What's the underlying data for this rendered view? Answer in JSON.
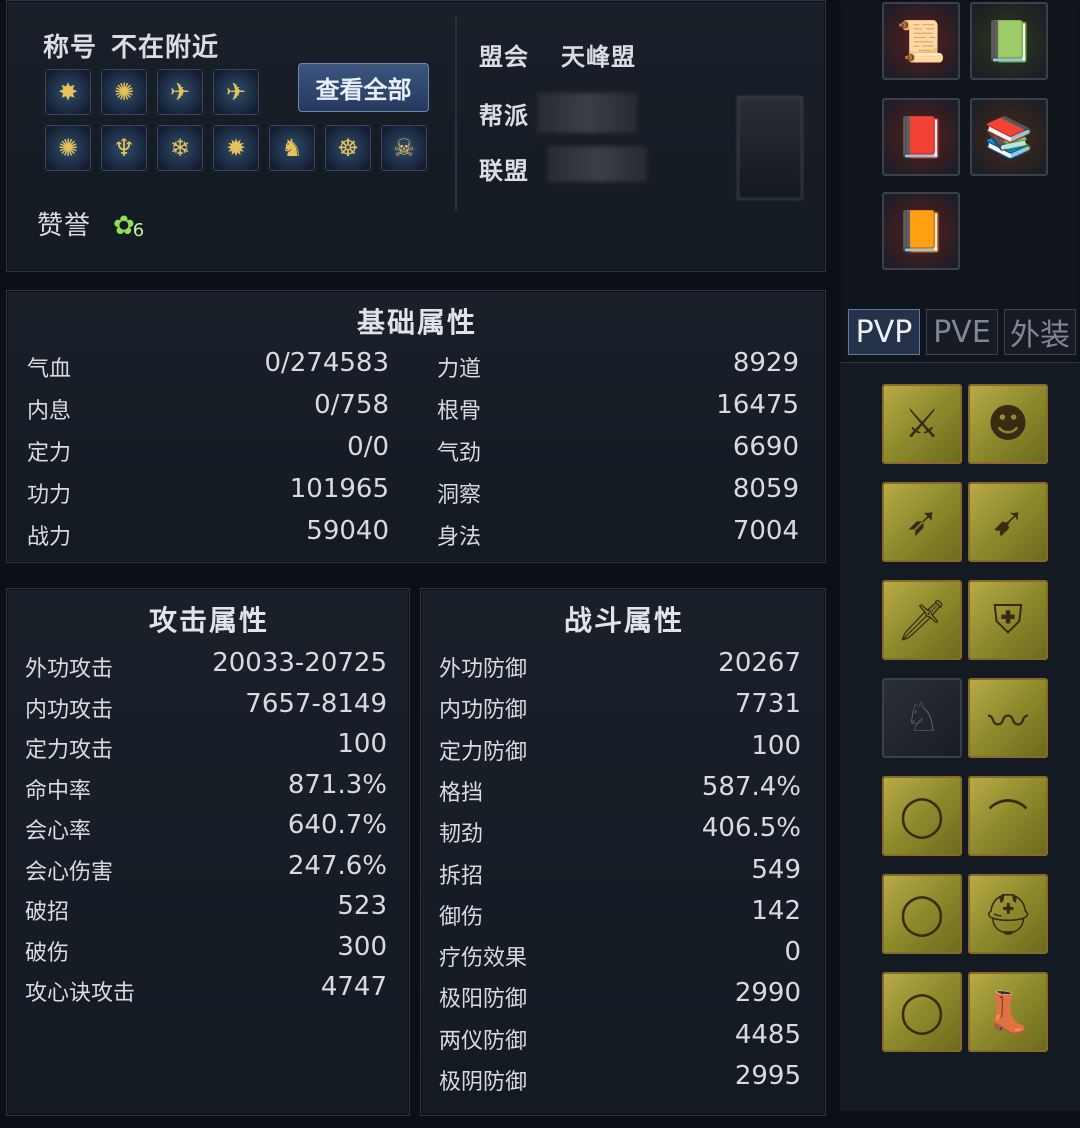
{
  "profile": {
    "title_label": "称号",
    "title_value": "不在附近",
    "view_all": "查看全部",
    "praise_label": "赞誉",
    "praise_count": "6",
    "alliance_label": "盟会",
    "alliance_value": "天峰盟",
    "sect_label": "帮派",
    "union_label": "联盟",
    "title_icons": [
      "red-fan-emblem",
      "gold-fan-emblem",
      "blue-bird-emblem",
      "blue-bird-emblem",
      "gold-fan-emblem",
      "blue-flame-emblem",
      "snowflake-emblem",
      "red-star-emblem",
      "warrior-emblem",
      "gold-mask-emblem",
      "skull-emblem"
    ]
  },
  "basic": {
    "title": "基础属性",
    "left": [
      {
        "label": "气血",
        "value": "0/274583"
      },
      {
        "label": "内息",
        "value": "0/758"
      },
      {
        "label": "定力",
        "value": "0/0"
      },
      {
        "label": "功力",
        "value": "101965"
      },
      {
        "label": "战力",
        "value": "59040"
      }
    ],
    "right": [
      {
        "label": "力道",
        "value": "8929"
      },
      {
        "label": "根骨",
        "value": "16475"
      },
      {
        "label": "气劲",
        "value": "6690"
      },
      {
        "label": "洞察",
        "value": "8059"
      },
      {
        "label": "身法",
        "value": "7004"
      }
    ]
  },
  "attack": {
    "title": "攻击属性",
    "rows": [
      {
        "label": "外功攻击",
        "value": "20033-20725"
      },
      {
        "label": "内功攻击",
        "value": "7657-8149"
      },
      {
        "label": "定力攻击",
        "value": "100"
      },
      {
        "label": "命中率",
        "value": "871.3%"
      },
      {
        "label": "会心率",
        "value": "640.7%"
      },
      {
        "label": "会心伤害",
        "value": "247.6%"
      },
      {
        "label": "破招",
        "value": "523"
      },
      {
        "label": "破伤",
        "value": "300"
      },
      {
        "label": "攻心诀攻击",
        "value": "4747"
      }
    ]
  },
  "combat": {
    "title": "战斗属性",
    "rows": [
      {
        "label": "外功防御",
        "value": "20267"
      },
      {
        "label": "内功防御",
        "value": "7731"
      },
      {
        "label": "定力防御",
        "value": "100"
      },
      {
        "label": "格挡",
        "value": "587.4%"
      },
      {
        "label": "韧劲",
        "value": "406.5%"
      },
      {
        "label": "拆招",
        "value": "549"
      },
      {
        "label": "御伤",
        "value": "142"
      },
      {
        "label": "疗伤效果",
        "value": "0"
      },
      {
        "label": "极阳防御",
        "value": "2990"
      },
      {
        "label": "两仪防御",
        "value": "4485"
      },
      {
        "label": "极阴防御",
        "value": "2995"
      }
    ]
  },
  "tabs": [
    "PVP",
    "PVE",
    "外装"
  ],
  "side_items": [
    "scroll-icon",
    "green-books-icon",
    "red-book-icon",
    "book-stack-icon",
    "red-tome-icon"
  ],
  "equipment": [
    {
      "left": "spear-icon",
      "right": "hair-portrait-icon"
    },
    {
      "left": "bow-icon",
      "right": "red-dart-icon"
    },
    {
      "left": "dagger-icon",
      "right": "armor-chest-icon"
    },
    {
      "left": "horse-icon",
      "right": "sash-icon"
    },
    {
      "left": "ring-icon",
      "right": "bracer-icon"
    },
    {
      "left": "ring-icon",
      "right": "helmet-icon"
    },
    {
      "left": "ring-icon",
      "right": "boots-icon"
    }
  ],
  "colors": {
    "accent": "#5a7aa8",
    "gold": "#b8aa47",
    "background": "#0b0f16"
  }
}
